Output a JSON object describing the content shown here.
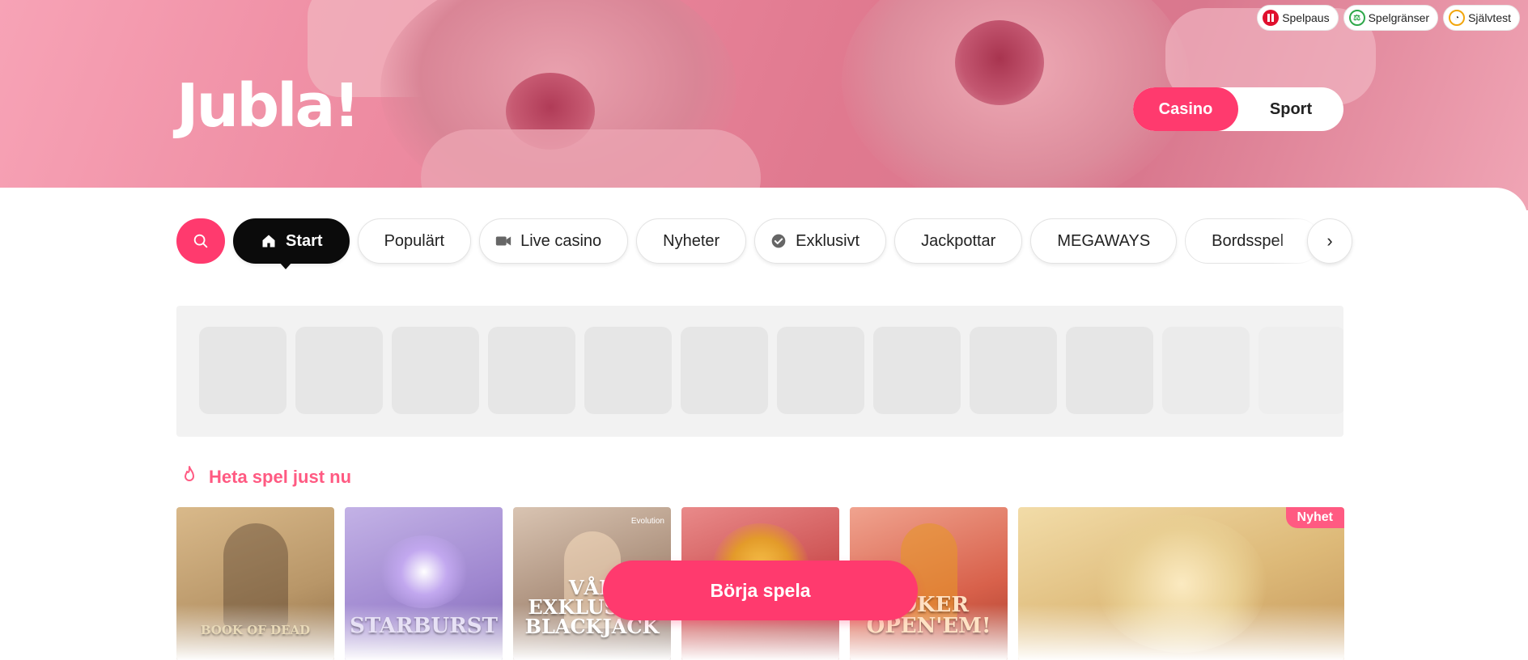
{
  "brand": {
    "logo_text": "Jubla!",
    "accent": "#ff3a6e"
  },
  "responsible_gaming": [
    {
      "label": "Spelpaus",
      "icon": "pause-icon"
    },
    {
      "label": "Spelgränser",
      "icon": "limits-icon"
    },
    {
      "label": "Självtest",
      "icon": "gauge-icon"
    }
  ],
  "mode_switch": {
    "casino": "Casino",
    "sport": "Sport",
    "active": "Casino"
  },
  "nav": {
    "tabs": [
      {
        "label": "Start",
        "icon": "home-icon",
        "active": true
      },
      {
        "label": "Populärt"
      },
      {
        "label": "Live casino",
        "icon": "video-camera-icon"
      },
      {
        "label": "Nyheter"
      },
      {
        "label": "Exklusivt",
        "icon": "check-circle-icon"
      },
      {
        "label": "Jackpottar"
      },
      {
        "label": "MEGAWAYS"
      },
      {
        "label": "Bordsspel"
      }
    ],
    "next_icon": "chevron-right-icon"
  },
  "section": {
    "title": "Heta spel just nu",
    "icon": "flame-icon"
  },
  "games": [
    {
      "title": "BOOK OF DEAD"
    },
    {
      "title": "STARBURST"
    },
    {
      "title": "VÅR EXKLUSIVA BLACKJACK",
      "provider": "Evolution"
    },
    {
      "title": ""
    },
    {
      "title": "JOKER OPEN'EM!"
    },
    {
      "title": "",
      "badge": "Nyhet"
    }
  ],
  "cta": {
    "label": "Börja spela"
  }
}
